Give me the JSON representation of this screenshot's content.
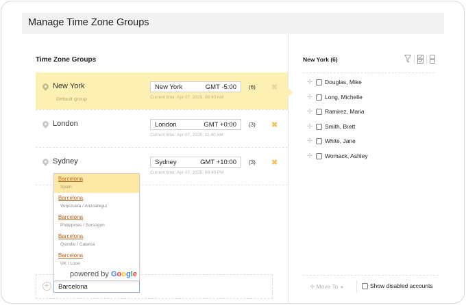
{
  "header": {
    "title": "Manage Time Zone Groups"
  },
  "left_panel": {
    "heading": "Time Zone Groups",
    "groups": [
      {
        "name": "New York",
        "subtitle": "Default group",
        "tz_city": "New York",
        "tz_gmt": "GMT -5:00",
        "current_time": "Current time: Apr 07, 2025, 06:40 AM",
        "count": "(6)",
        "selected": true
      },
      {
        "name": "London",
        "tz_city": "London",
        "tz_gmt": "GMT +0:00",
        "current_time": "Current time: Apr 07, 2025, 11:40 AM",
        "count": "(3)"
      },
      {
        "name": "Sydney",
        "tz_city": "Sydney",
        "tz_gmt": "GMT +10:00",
        "current_time": "Current time: Apr 07, 2025, 08:40 PM",
        "count": "(3)"
      }
    ],
    "autocomplete": {
      "items": [
        {
          "title": "Barcelona",
          "sub": "Spain"
        },
        {
          "title": "Barcelona",
          "sub": "Venezuela / Anzoategui"
        },
        {
          "title": "Barcelona",
          "sub": "Philippines / Sorsogon"
        },
        {
          "title": "Barcelona",
          "sub": "Quindio / Calarca"
        },
        {
          "title": "Barcelona",
          "sub": "UK / Looe"
        }
      ],
      "powered_by": "powered by",
      "brand": {
        "G": "G",
        "o1": "o",
        "o2": "o",
        "g": "g",
        "l": "l",
        "e": "e"
      }
    },
    "add_input_value": "Barcelona",
    "add_icon": "+"
  },
  "right_panel": {
    "heading": "New York (6)",
    "icons": [
      "filter-icon",
      "checklist-icon",
      "columns-icon"
    ],
    "members": [
      "Douglas, Mike",
      "Long, Michelle",
      "Ramirez, Maria",
      "Smith, Brett",
      "White, Jane",
      "Womack, Ashley"
    ],
    "move_to_label": "Move To",
    "show_disabled_label": "Show disabled accounts"
  },
  "colors": {
    "selected_row": "#fdf0b3",
    "delete_x": "#f0c566",
    "link": "#b5651d"
  }
}
